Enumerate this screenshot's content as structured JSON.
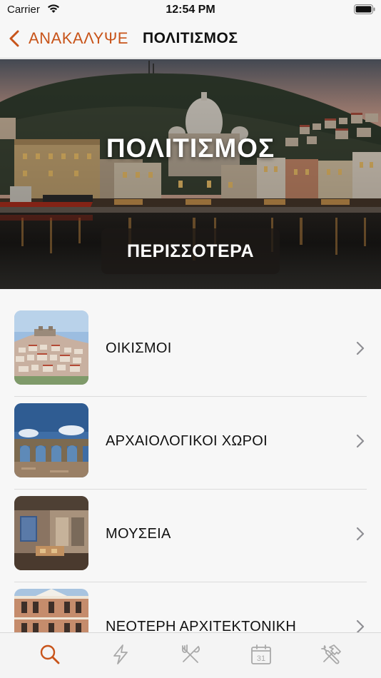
{
  "status_bar": {
    "carrier": "Carrier",
    "time": "12:54 PM"
  },
  "nav": {
    "back_label": "ΑΝΑΚΑΛΥΨΕ",
    "title": "ΠΟΛΙΤΙΣΜΟΣ"
  },
  "hero": {
    "title": "ΠΟΛΙΤΙΣΜΟΣ",
    "button_label": "ΠΕΡΙΣΣΟΤΕΡΑ"
  },
  "list": {
    "items": [
      {
        "label": "ΟΙΚΙΣΜΟΙ",
        "thumb_icon": "hilltop-town-thumbnail"
      },
      {
        "label": "ΑΡΧΑΙΟΛΟΓΙΚΟΙ ΧΩΡΟΙ",
        "thumb_icon": "aqueduct-thumbnail"
      },
      {
        "label": "ΜΟΥΣΕΙΑ",
        "thumb_icon": "museum-interior-thumbnail"
      },
      {
        "label": "ΝΕΟΤΕΡΗ ΑΡΧΙΤΕΚΤΟΝΙΚΗ",
        "thumb_icon": "neoclassical-building-thumbnail"
      }
    ]
  },
  "tab_bar": {
    "tabs": [
      {
        "icon": "search-icon",
        "selected": true
      },
      {
        "icon": "lightning-icon",
        "selected": false
      },
      {
        "icon": "fork-knife-icon",
        "selected": false
      },
      {
        "icon": "calendar-icon",
        "selected": false,
        "calendar_day": "31"
      },
      {
        "icon": "tools-icon",
        "selected": false
      }
    ]
  },
  "colors": {
    "accent": "#c8541a",
    "tab_inactive": "#a9a9a9",
    "background": "#f7f7f7"
  }
}
